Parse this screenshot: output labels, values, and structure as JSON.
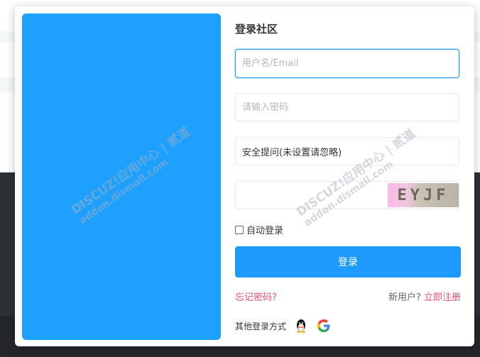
{
  "dialog": {
    "title": "登录社区",
    "username": {
      "placeholder": "用户名/Email",
      "value": ""
    },
    "password": {
      "placeholder": "请输入密码",
      "value": ""
    },
    "security_question": {
      "selected": "安全提问(未设置请忽略)"
    },
    "captcha": {
      "value": "",
      "image_text": "EYJF"
    },
    "remember": {
      "label": "自动登录",
      "checked": false
    },
    "login_button": "登录",
    "forgot_password": "忘记密码?",
    "new_user_prefix": "新用户?",
    "register_link": "立即注册",
    "other_login_label": "其他登录方式",
    "social": [
      "qq-icon",
      "google-icon"
    ]
  },
  "watermark": {
    "line1": "DISCUZ!应用中心 | 贰道",
    "line2": "addon.dismall.com"
  },
  "colors": {
    "accent": "#1e9bff",
    "side_panel": "#1ea0ff",
    "link": "#e84b70"
  }
}
